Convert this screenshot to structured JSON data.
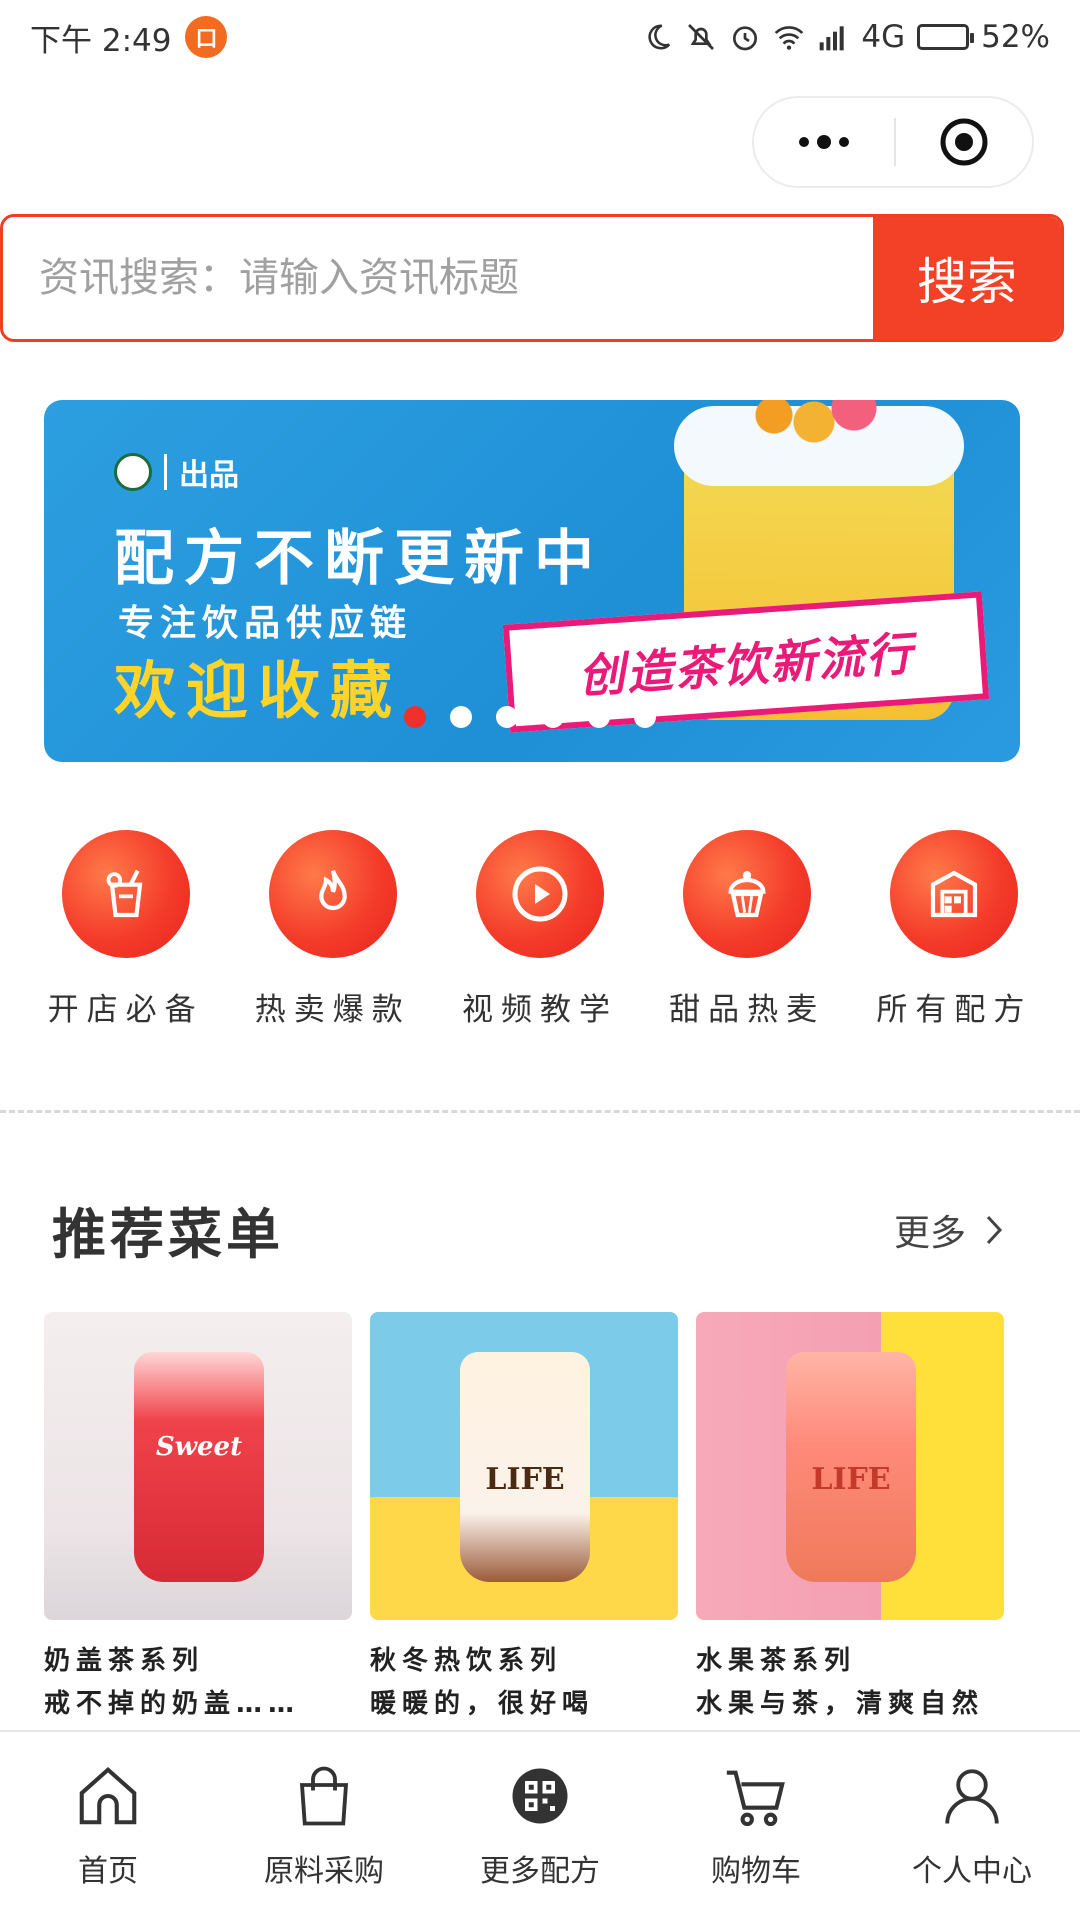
{
  "status_bar": {
    "time": "下午 2:49",
    "app_badge": "口",
    "network": "4G",
    "battery_text": "52%",
    "battery_level": 0.52
  },
  "search": {
    "placeholder": "资讯搜索：请输入资讯标题",
    "button_label": "搜索"
  },
  "banner": {
    "brand": "出品",
    "headline": "配方不断更新中",
    "subline": "专注饮品供应链",
    "slogan": "欢迎收藏",
    "tag": "创造茶饮新流行",
    "slide_count": 6,
    "active_slide": 0
  },
  "categories": [
    {
      "label": "开店必备",
      "icon": "drink-cup-icon"
    },
    {
      "label": "热卖爆款",
      "icon": "flame-icon"
    },
    {
      "label": "视频教学",
      "icon": "play-icon"
    },
    {
      "label": "甜品热麦",
      "icon": "cupcake-icon"
    },
    {
      "label": "所有配方",
      "icon": "warehouse-icon"
    }
  ],
  "recommend": {
    "title": "推荐菜单",
    "more_label": "更多",
    "items": [
      {
        "line1": "奶盖茶系列",
        "line2": "戒不掉的奶盖……",
        "cup_text": "Sweet"
      },
      {
        "line1": "秋冬热饮系列",
        "line2": "暖暖的，很好喝",
        "cup_text": "LIFE"
      },
      {
        "line1": "水果茶系列",
        "line2": "水果与茶，清爽自然",
        "cup_text": "LIFE"
      }
    ]
  },
  "tabbar": [
    {
      "label": "首页",
      "icon": "home-icon"
    },
    {
      "label": "原料采购",
      "icon": "shopping-bag-icon"
    },
    {
      "label": "更多配方",
      "icon": "qr-code-icon"
    },
    {
      "label": "购物车",
      "icon": "cart-icon"
    },
    {
      "label": "个人中心",
      "icon": "user-icon"
    }
  ],
  "colors": {
    "accent": "#f24126",
    "banner_blue": "#2c9fe0",
    "slogan_yellow": "#ffd42a",
    "tag_pink": "#ea1b78"
  }
}
